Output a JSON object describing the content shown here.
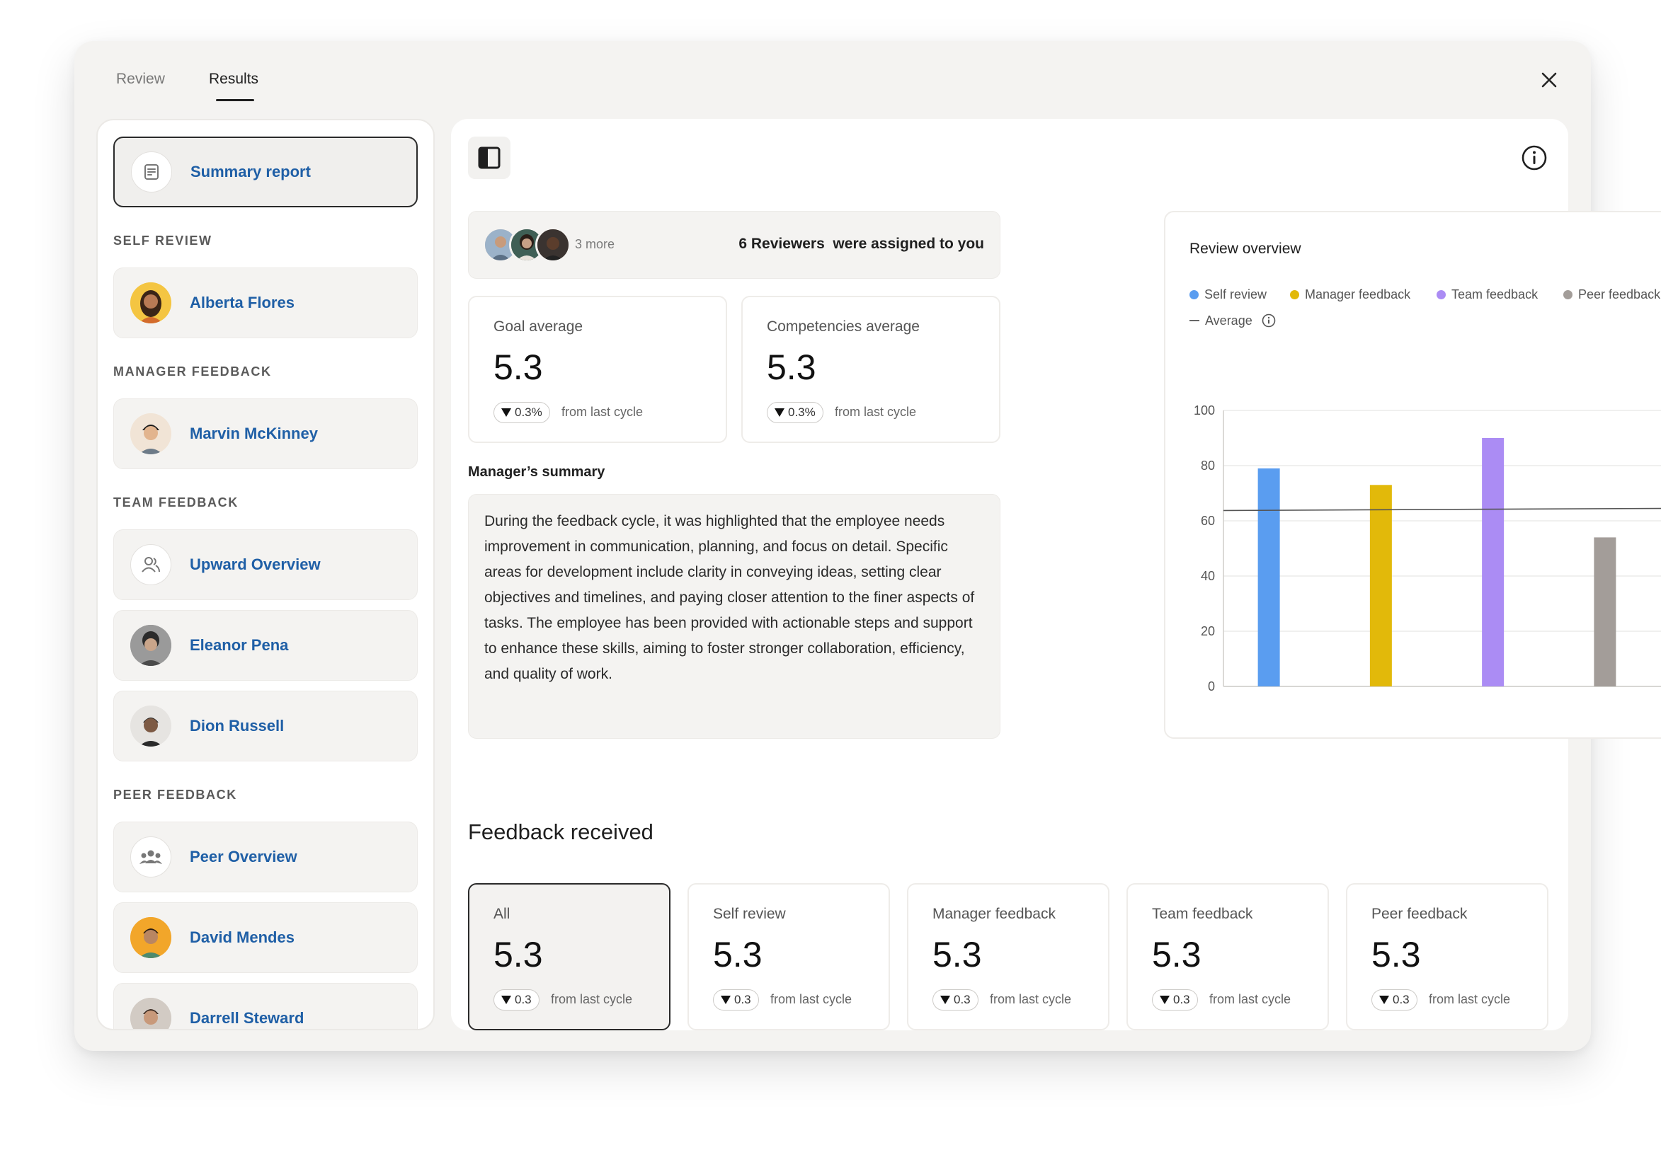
{
  "tabs": {
    "review": "Review",
    "results": "Results"
  },
  "sidebar": {
    "summary_label": "Summary report",
    "sections": {
      "self_review": "SELF REVIEW",
      "manager_feedback": "MANAGER FEEDBACK",
      "team_feedback": "TEAM FEEDBACK",
      "peer_feedback": "PEER FEEDBACK"
    },
    "items": {
      "alberta": "Alberta Flores",
      "marvin": "Marvin McKinney",
      "upward": "Upward Overview",
      "eleanor": "Eleanor Pena",
      "dion": "Dion Russell",
      "peer_overview": "Peer Overview",
      "david": "David Mendes",
      "darrell": "Darrell Steward"
    }
  },
  "reviewers": {
    "more": "3 more",
    "text": "6 Reviewers  were assigned to you"
  },
  "goal": {
    "title": "Goal average",
    "value": "5.3",
    "delta": "0.3%",
    "sub": "from last cycle"
  },
  "competencies": {
    "title": "Competencies average",
    "value": "5.3",
    "delta": "0.3%",
    "sub": "from last cycle"
  },
  "manager_summary": {
    "label": "Manager’s summary",
    "text": "During the feedback cycle, it was highlighted that the employee needs improvement in communication, planning, and focus on detail. Specific areas for development include clarity in conveying ideas, setting clear objectives and timelines, and paying closer attention to the finer aspects of tasks. The employee has been provided with actionable steps and support to enhance these skills, aiming to foster stronger collaboration, efficiency, and quality of work."
  },
  "chart_data": {
    "type": "bar",
    "title": "Review overview",
    "categories": [
      "Self review",
      "Manager feedback",
      "Team feedback",
      "Peer feedback"
    ],
    "values": [
      79,
      73,
      90,
      54
    ],
    "colors": [
      "#5a9df0",
      "#e2b90a",
      "#ab8cf4",
      "#a39d99"
    ],
    "average": 64,
    "average_label": "Average",
    "ylim": [
      0,
      100
    ],
    "yticks": [
      "0",
      "20",
      "40",
      "60",
      "80",
      "100"
    ],
    "grid": true,
    "legend_placement": "top"
  },
  "feedback_received": {
    "title": "Feedback received",
    "cards": [
      {
        "title": "All",
        "value": "5.3",
        "delta": "0.3",
        "sub": "from last cycle"
      },
      {
        "title": "Self review",
        "value": "5.3",
        "delta": "0.3",
        "sub": "from last cycle"
      },
      {
        "title": "Manager feedback",
        "value": "5.3",
        "delta": "0.3",
        "sub": "from last cycle"
      },
      {
        "title": "Team feedback",
        "value": "5.3",
        "delta": "0.3",
        "sub": "from last cycle"
      },
      {
        "title": "Peer feedback",
        "value": "5.3",
        "delta": "0.3",
        "sub": "from last cycle"
      }
    ]
  }
}
